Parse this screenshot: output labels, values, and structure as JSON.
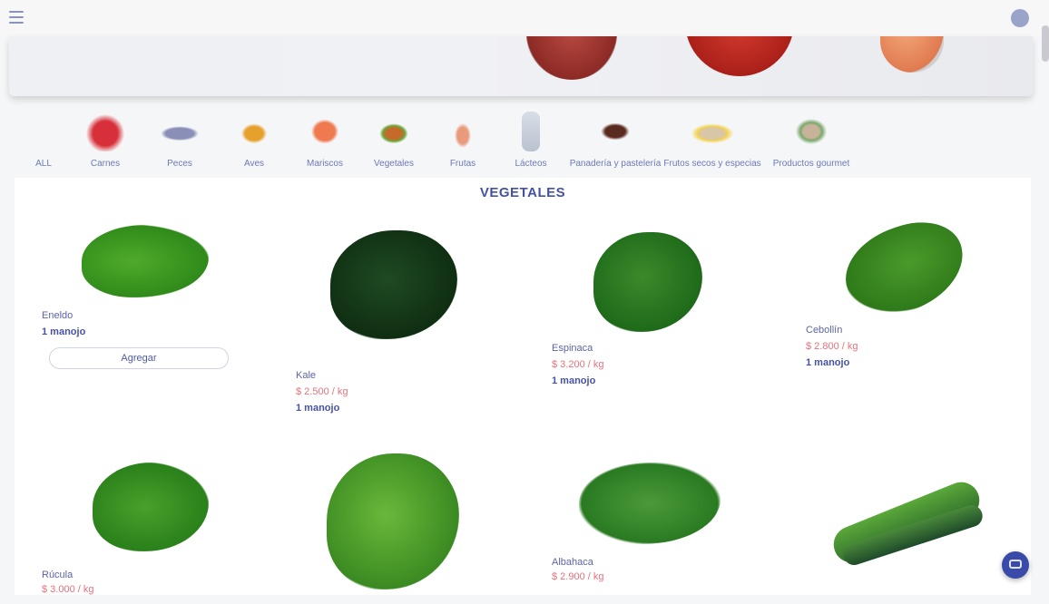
{
  "colors": {
    "accent": "#4452a6",
    "price": "#e8707a",
    "background": "#f5f6f8"
  },
  "header": {
    "menu_icon": "menu-icon",
    "user_icon": "user-icon"
  },
  "categories": [
    {
      "label": "ALL",
      "icon": "all-icon"
    },
    {
      "label": "Carnes",
      "icon": "meat-icon"
    },
    {
      "label": "Peces",
      "icon": "fish-icon"
    },
    {
      "label": "Aves",
      "icon": "poultry-icon"
    },
    {
      "label": "Mariscos",
      "icon": "seafood-icon"
    },
    {
      "label": "Vegetales",
      "icon": "vegetables-icon"
    },
    {
      "label": "Frutas",
      "icon": "fruits-icon"
    },
    {
      "label": "Lácteos",
      "icon": "dairy-icon"
    },
    {
      "label": "Panadería y pastelería",
      "icon": "bakery-icon"
    },
    {
      "label": "Frutos secos y especias",
      "icon": "nuts-icon"
    },
    {
      "label": "Productos gourmet",
      "icon": "gourmet-icon"
    }
  ],
  "section": {
    "title": "VEGETALES"
  },
  "products": [
    {
      "name": "Eneldo",
      "price": "",
      "unit": "1 manojo",
      "button": "Agregar"
    },
    {
      "name": "Kale",
      "price": "$ 2.500 / kg",
      "unit": "1 manojo",
      "button": ""
    },
    {
      "name": "Espinaca",
      "price": "$ 3.200 / kg",
      "unit": "1 manojo",
      "button": ""
    },
    {
      "name": "Cebollín",
      "price": "$ 2.800 / kg",
      "unit": "1 manojo",
      "button": ""
    },
    {
      "name": "Rúcula",
      "price": "$ 3.000 / kg",
      "unit": "",
      "button": ""
    },
    {
      "name": "",
      "price": "",
      "unit": "",
      "button": ""
    },
    {
      "name": "Albahaca",
      "price": "$ 2.900 / kg",
      "unit": "",
      "button": ""
    },
    {
      "name": "",
      "price": "",
      "unit": "",
      "button": ""
    }
  ],
  "chat": {
    "icon": "chat-icon"
  }
}
